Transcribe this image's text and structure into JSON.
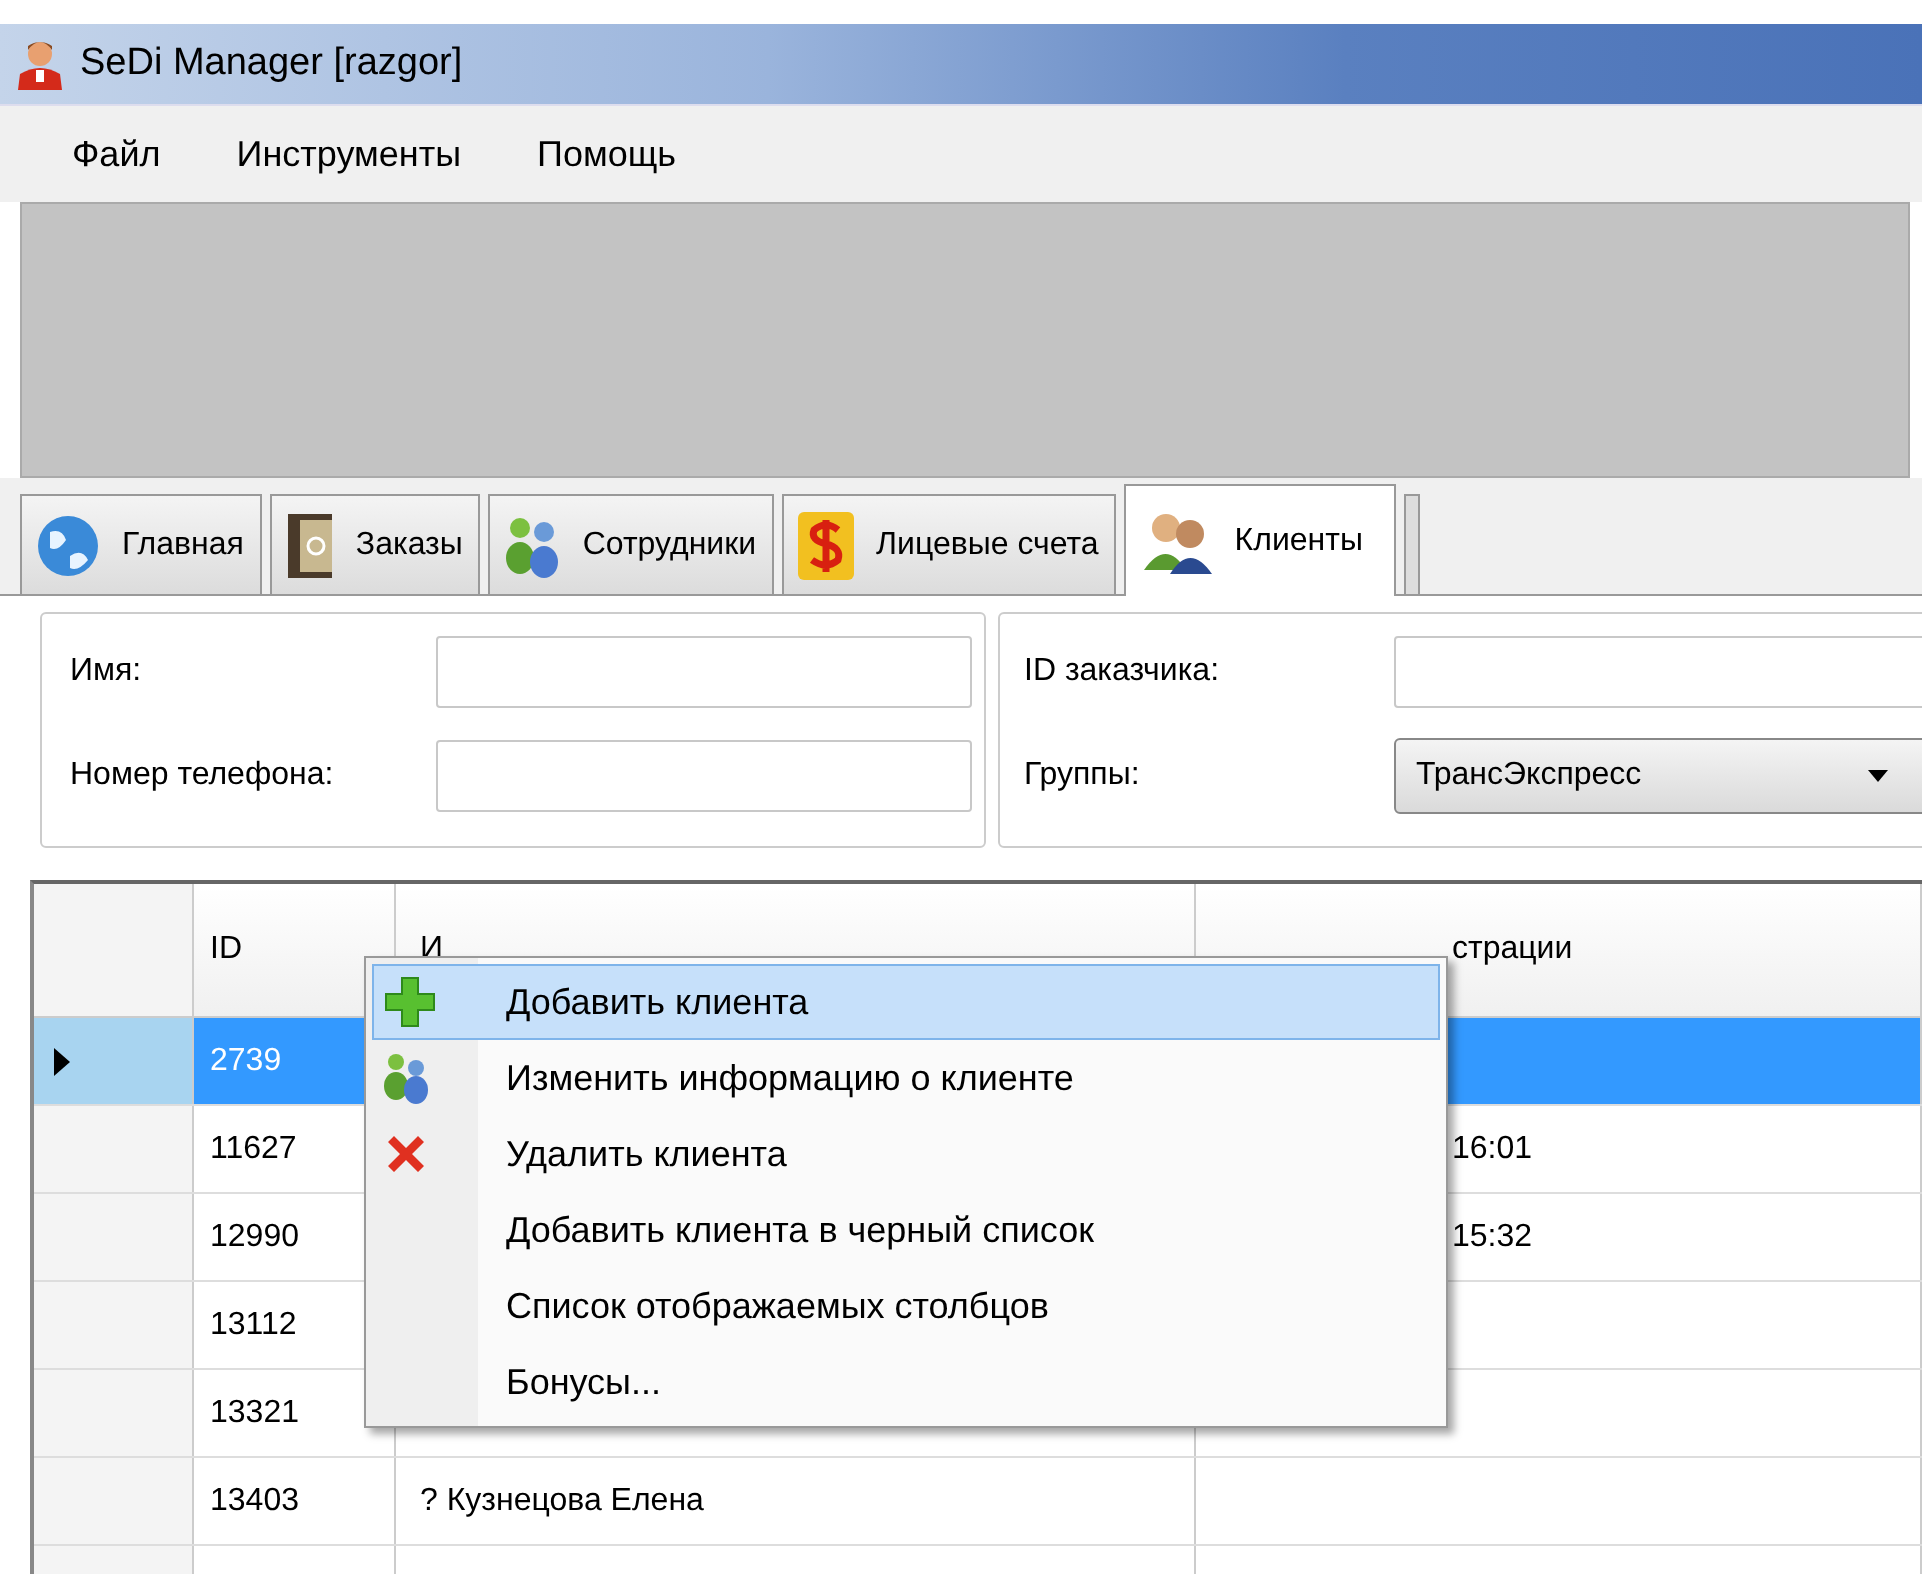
{
  "window": {
    "title": "SeDi Manager [razgor]"
  },
  "menu": [
    {
      "label": "Файл"
    },
    {
      "label": "Инструменты"
    },
    {
      "label": "Помощь"
    }
  ],
  "tabs": [
    {
      "label": "Главная",
      "selected": false
    },
    {
      "label": "Заказы",
      "selected": false
    },
    {
      "label": "Сотрудники",
      "selected": false
    },
    {
      "label": "Лицевые счета",
      "selected": false
    },
    {
      "label": "Клиенты",
      "selected": true
    }
  ],
  "filter_groups": [
    {
      "fields": [
        {
          "label": "Имя:",
          "kind": "text"
        },
        {
          "label": "Номер телефона:",
          "kind": "text"
        }
      ]
    },
    {
      "fields": [
        {
          "label": "ID заказчика:",
          "kind": "text"
        },
        {
          "label": "Группы:",
          "kind": "dropdown",
          "value": "ТрансЭкспресс"
        }
      ]
    }
  ],
  "table": {
    "columns": [
      "ID",
      "И",
      "страции"
    ],
    "rows": [
      {
        "id": "2739",
        "selected": true
      },
      {
        "id": "11627",
        "column_3": "16:01",
        "selected": false
      },
      {
        "id": "12990",
        "column_3": "15:32",
        "selected": false
      },
      {
        "id": "13112",
        "selected": false
      },
      {
        "id": "13321",
        "selected": false
      },
      {
        "id": "13403",
        "column_2": "? Кузнецова Елена",
        "selected": false
      }
    ]
  },
  "context_menu": {
    "items": [
      {
        "label": "Добавить клиента",
        "selected": true
      },
      {
        "label": "Изменить информацию о клиенте",
        "selected": false
      },
      {
        "label": "Удалить клиента",
        "selected": false
      },
      {
        "label": "Добавить клиента в черный список",
        "selected": false
      },
      {
        "label": "Список отображаемых столбцов",
        "selected": false
      },
      {
        "label": "Бонусы...",
        "selected": false
      }
    ]
  }
}
